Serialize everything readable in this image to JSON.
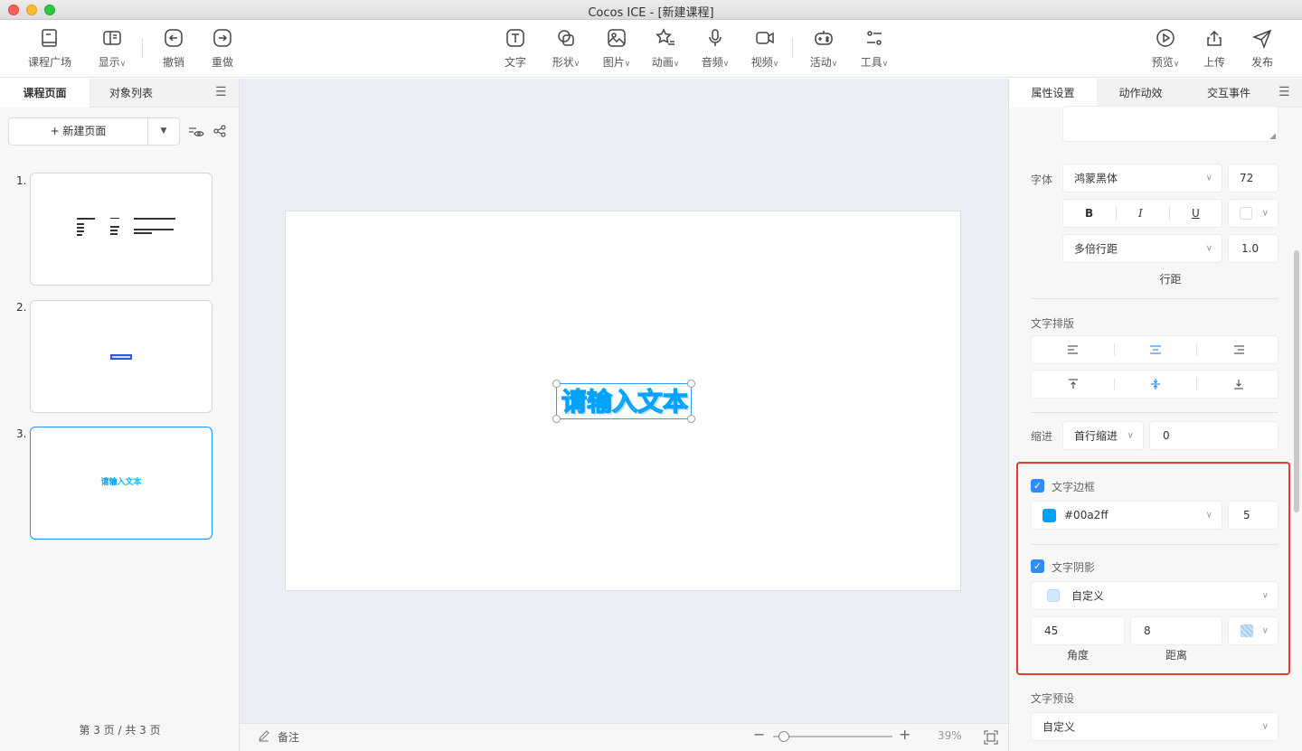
{
  "window": {
    "title": "Cocos ICE - [新建课程]"
  },
  "toolbar": {
    "left": [
      {
        "label": "课程广场"
      },
      {
        "label": "显示"
      },
      {
        "label": "撤销"
      },
      {
        "label": "重做"
      }
    ],
    "center": [
      {
        "label": "文字"
      },
      {
        "label": "形状"
      },
      {
        "label": "图片"
      },
      {
        "label": "动画"
      },
      {
        "label": "音频"
      },
      {
        "label": "视频"
      },
      {
        "label": "活动"
      },
      {
        "label": "工具"
      }
    ],
    "right": [
      {
        "label": "预览"
      },
      {
        "label": "上传"
      },
      {
        "label": "发布"
      }
    ]
  },
  "left_panel": {
    "tabs": [
      {
        "label": "课程页面"
      },
      {
        "label": "对象列表"
      }
    ],
    "new_page_label": "+ 新建页面",
    "pages": [
      {
        "num": "1."
      },
      {
        "num": "2."
      },
      {
        "num": "3."
      }
    ],
    "page_count": "第 3 页 / 共 3 页"
  },
  "canvas": {
    "text": "请输入文本",
    "notes_label": "备注",
    "zoom": "39%",
    "zoom_value": 0.39
  },
  "right_panel": {
    "tabs": [
      {
        "label": "属性设置"
      },
      {
        "label": "动作动效"
      },
      {
        "label": "交互事件"
      }
    ],
    "font": {
      "label": "字体",
      "family": "鸿蒙黑体",
      "size": "72",
      "bold": "B",
      "italic": "I",
      "underline": "U",
      "line_spacing_mode": "多倍行距",
      "line_spacing_value": "1.0",
      "line_spacing_label": "行距"
    },
    "layout": {
      "label": "文字排版"
    },
    "indent": {
      "label": "缩进",
      "mode": "首行缩进",
      "value": "0"
    },
    "border": {
      "label": "文字边框",
      "color": "#00a2ff",
      "color_label": "#00a2ff",
      "width": "5",
      "checked": true
    },
    "shadow": {
      "label": "文字阴影",
      "preset": "自定义",
      "angle": "45",
      "angle_label": "角度",
      "distance": "8",
      "distance_label": "距离",
      "checked": true
    },
    "preset": {
      "label": "文字预设",
      "value": "自定义"
    }
  }
}
